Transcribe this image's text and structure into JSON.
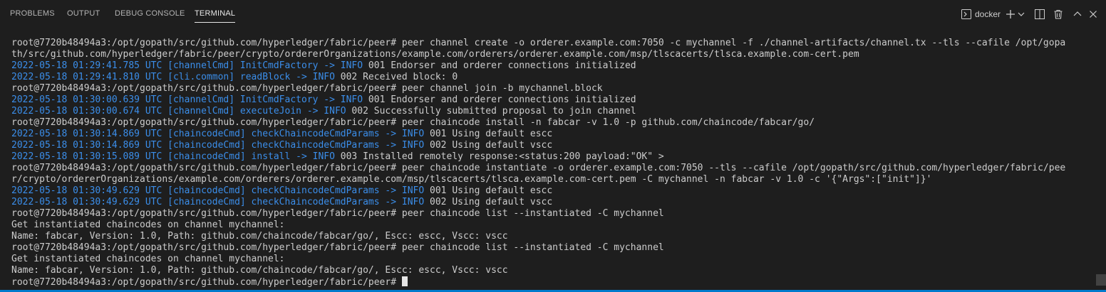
{
  "tabs": [
    {
      "label": "PROBLEMS"
    },
    {
      "label": "OUTPUT"
    },
    {
      "label": "DEBUG CONSOLE"
    },
    {
      "label": "TERMINAL"
    }
  ],
  "toolbar": {
    "shell_label": "docker",
    "icons": [
      "terminal-icon",
      "plus-icon",
      "chevron-down-icon",
      "split-icon",
      "trash-icon",
      "chevron-up-icon",
      "close-icon"
    ]
  },
  "colors": {
    "background": "#1e1e1e",
    "log_blue": "#3b8eea",
    "text": "#cccccc",
    "accent": "#007acc"
  },
  "terminal": {
    "prompt": "root@7720b48494a3:/opt/gopath/src/github.com/hyperledger/fabric/peer#",
    "lines": [
      "root@7720b48494a3:/opt/gopath/src/github.com/hyperledger/fabric/peer# peer channel create -o orderer.example.com:7050 -c mychannel -f ./channel-artifacts/channel.tx --tls --cafile /opt/gopa",
      "th/src/github.com/hyperledger/fabric/peer/crypto/ordererOrganizations/example.com/orderers/orderer.example.com/msp/tlscacerts/tlsca.example.com-cert.pem",
      "2022-05-18 01:29:41.785 UTC [channelCmd] InitCmdFactory -> INFO 001 Endorser and orderer connections initialized",
      "2022-05-18 01:29:41.810 UTC [cli.common] readBlock -> INFO 002 Received block: 0",
      "root@7720b48494a3:/opt/gopath/src/github.com/hyperledger/fabric/peer# peer channel join -b mychannel.block",
      "2022-05-18 01:30:00.639 UTC [channelCmd] InitCmdFactory -> INFO 001 Endorser and orderer connections initialized",
      "2022-05-18 01:30:00.674 UTC [channelCmd] executeJoin -> INFO 002 Successfully submitted proposal to join channel",
      "root@7720b48494a3:/opt/gopath/src/github.com/hyperledger/fabric/peer# peer chaincode install -n fabcar -v 1.0 -p github.com/chaincode/fabcar/go/",
      "2022-05-18 01:30:14.869 UTC [chaincodeCmd] checkChaincodeCmdParams -> INFO 001 Using default escc",
      "2022-05-18 01:30:14.869 UTC [chaincodeCmd] checkChaincodeCmdParams -> INFO 002 Using default vscc",
      "2022-05-18 01:30:15.089 UTC [chaincodeCmd] install -> INFO 003 Installed remotely response:<status:200 payload:\"OK\" >",
      "root@7720b48494a3:/opt/gopath/src/github.com/hyperledger/fabric/peer# peer chaincode instantiate -o orderer.example.com:7050 --tls --cafile /opt/gopath/src/github.com/hyperledger/fabric/pee",
      "r/crypto/ordererOrganizations/example.com/orderers/orderer.example.com/msp/tlscacerts/tlsca.example.com-cert.pem -C mychannel -n fabcar -v 1.0 -c '{\"Args\":[\"init\"]}'",
      "2022-05-18 01:30:49.629 UTC [chaincodeCmd] checkChaincodeCmdParams -> INFO 001 Using default escc",
      "2022-05-18 01:30:49.629 UTC [chaincodeCmd] checkChaincodeCmdParams -> INFO 002 Using default vscc",
      "root@7720b48494a3:/opt/gopath/src/github.com/hyperledger/fabric/peer# peer chaincode list --instantiated -C mychannel",
      "Get instantiated chaincodes on channel mychannel:",
      "Name: fabcar, Version: 1.0, Path: github.com/chaincode/fabcar/go/, Escc: escc, Vscc: vscc",
      "root@7720b48494a3:/opt/gopath/src/github.com/hyperledger/fabric/peer# peer chaincode list --instantiated -C mychannel",
      "Get instantiated chaincodes on channel mychannel:",
      "Name: fabcar, Version: 1.0, Path: github.com/chaincode/fabcar/go/, Escc: escc, Vscc: vscc"
    ]
  }
}
